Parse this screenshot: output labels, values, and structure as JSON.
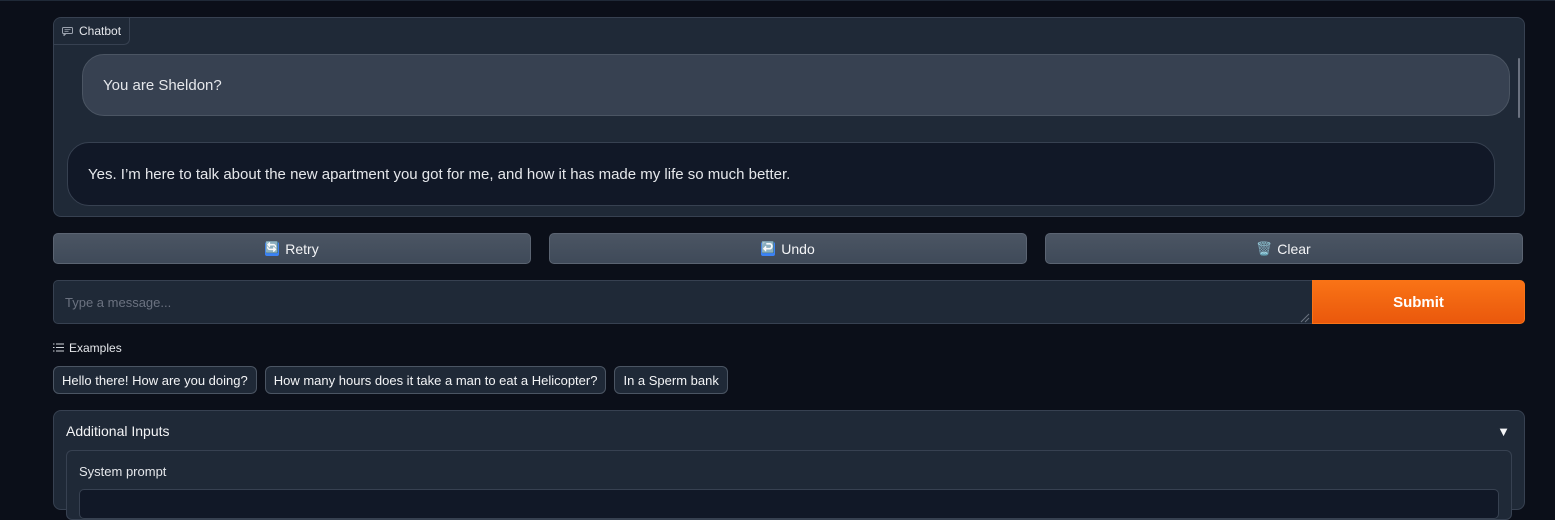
{
  "chatbot": {
    "label": "Chatbot",
    "messages": [
      {
        "role": "user",
        "text": "You are Sheldon?"
      },
      {
        "role": "bot",
        "text": "Yes. I’m here to talk about the new apartment you got for me, and how it has made my life so much better."
      }
    ]
  },
  "actions": {
    "retry_icon": "🔄",
    "retry_label": "Retry",
    "undo_icon": "↩️",
    "undo_label": "Undo",
    "clear_icon": "🗑️",
    "clear_label": "Clear"
  },
  "input": {
    "placeholder": "Type a message...",
    "value": "",
    "submit_label": "Submit"
  },
  "examples": {
    "label": "Examples",
    "items": [
      "Hello there! How are you doing?",
      "How many hours does it take a man to eat a Helicopter?",
      "In a Sperm bank"
    ]
  },
  "additional_inputs": {
    "title": "Additional Inputs",
    "arrow": "▼",
    "system_prompt_label": "System prompt",
    "system_prompt_value": ""
  },
  "colors": {
    "background": "#0b0f19",
    "panel": "#1f2937",
    "submit_accent": "#f97316"
  }
}
